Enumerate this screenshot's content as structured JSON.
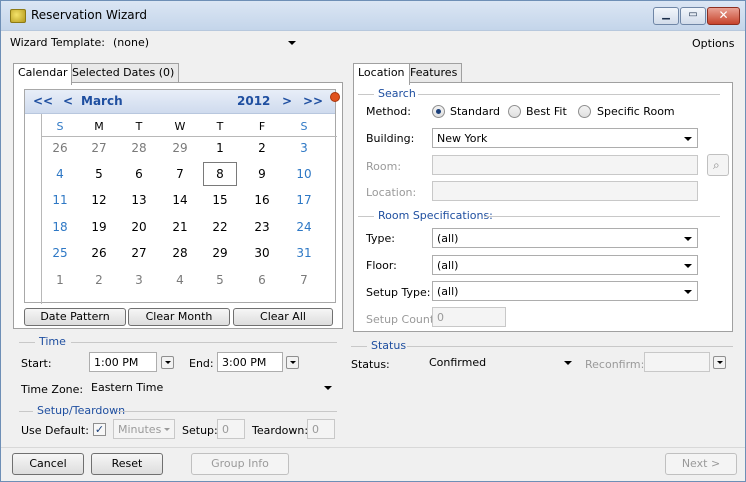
{
  "window": {
    "title": "Reservation Wizard"
  },
  "top": {
    "template_label": "Wizard Template:",
    "template_value": "(none)",
    "options": "Options"
  },
  "left_tabs": [
    "Calendar",
    "Selected Dates (0)"
  ],
  "calendar": {
    "prev_year": "<<",
    "prev_month": "<",
    "month": "March",
    "year": "2012",
    "next_month": ">",
    "next_year": ">>",
    "dow": [
      "S",
      "M",
      "T",
      "W",
      "T",
      "F",
      "S"
    ],
    "weeks": [
      [
        "26",
        "27",
        "28",
        "29",
        "1",
        "2",
        "3"
      ],
      [
        "4",
        "5",
        "6",
        "7",
        "8",
        "9",
        "10"
      ],
      [
        "11",
        "12",
        "13",
        "14",
        "15",
        "16",
        "17"
      ],
      [
        "18",
        "19",
        "20",
        "21",
        "22",
        "23",
        "24"
      ],
      [
        "25",
        "26",
        "27",
        "28",
        "29",
        "30",
        "31"
      ],
      [
        "1",
        "2",
        "3",
        "4",
        "5",
        "6",
        "7"
      ]
    ],
    "selected": "8",
    "buttons": {
      "date_pattern": "Date Pattern",
      "clear_month": "Clear Month",
      "clear_all": "Clear All"
    }
  },
  "time": {
    "group": "Time",
    "start_label": "Start:",
    "start_value": "1:00 PM",
    "end_label": "End:",
    "end_value": "3:00 PM",
    "tz_label": "Time Zone:",
    "tz_value": "Eastern Time"
  },
  "setup": {
    "group": "Setup/Teardown",
    "default_label": "Use Default:",
    "default_checked": true,
    "check_glyph": "✓",
    "units": "Minutes",
    "setup_label": "Setup:",
    "setup_value": "0",
    "teardown_label": "Teardown:",
    "teardown_value": "0"
  },
  "right_tabs": [
    "Location",
    "Features"
  ],
  "search": {
    "group": "Search",
    "method_label": "Method:",
    "methods": [
      "Standard",
      "Best Fit",
      "Specific Room"
    ],
    "selected_method": "Standard",
    "building_label": "Building:",
    "building_value": "New York",
    "room_label": "Room:",
    "location_label": "Location:"
  },
  "specs": {
    "group": "Room Specifications:",
    "type_label": "Type:",
    "type_value": "(all)",
    "floor_label": "Floor:",
    "floor_value": "(all)",
    "setup_type_label": "Setup Type:",
    "setup_type_value": "(all)",
    "setup_count_label": "Setup Count:",
    "setup_count_value": "0"
  },
  "status": {
    "group": "Status",
    "status_label": "Status:",
    "status_value": "Confirmed",
    "reconfirm_label": "Reconfirm:"
  },
  "footer": {
    "cancel": "Cancel",
    "reset": "Reset",
    "group_info": "Group Info",
    "next": "Next >"
  }
}
